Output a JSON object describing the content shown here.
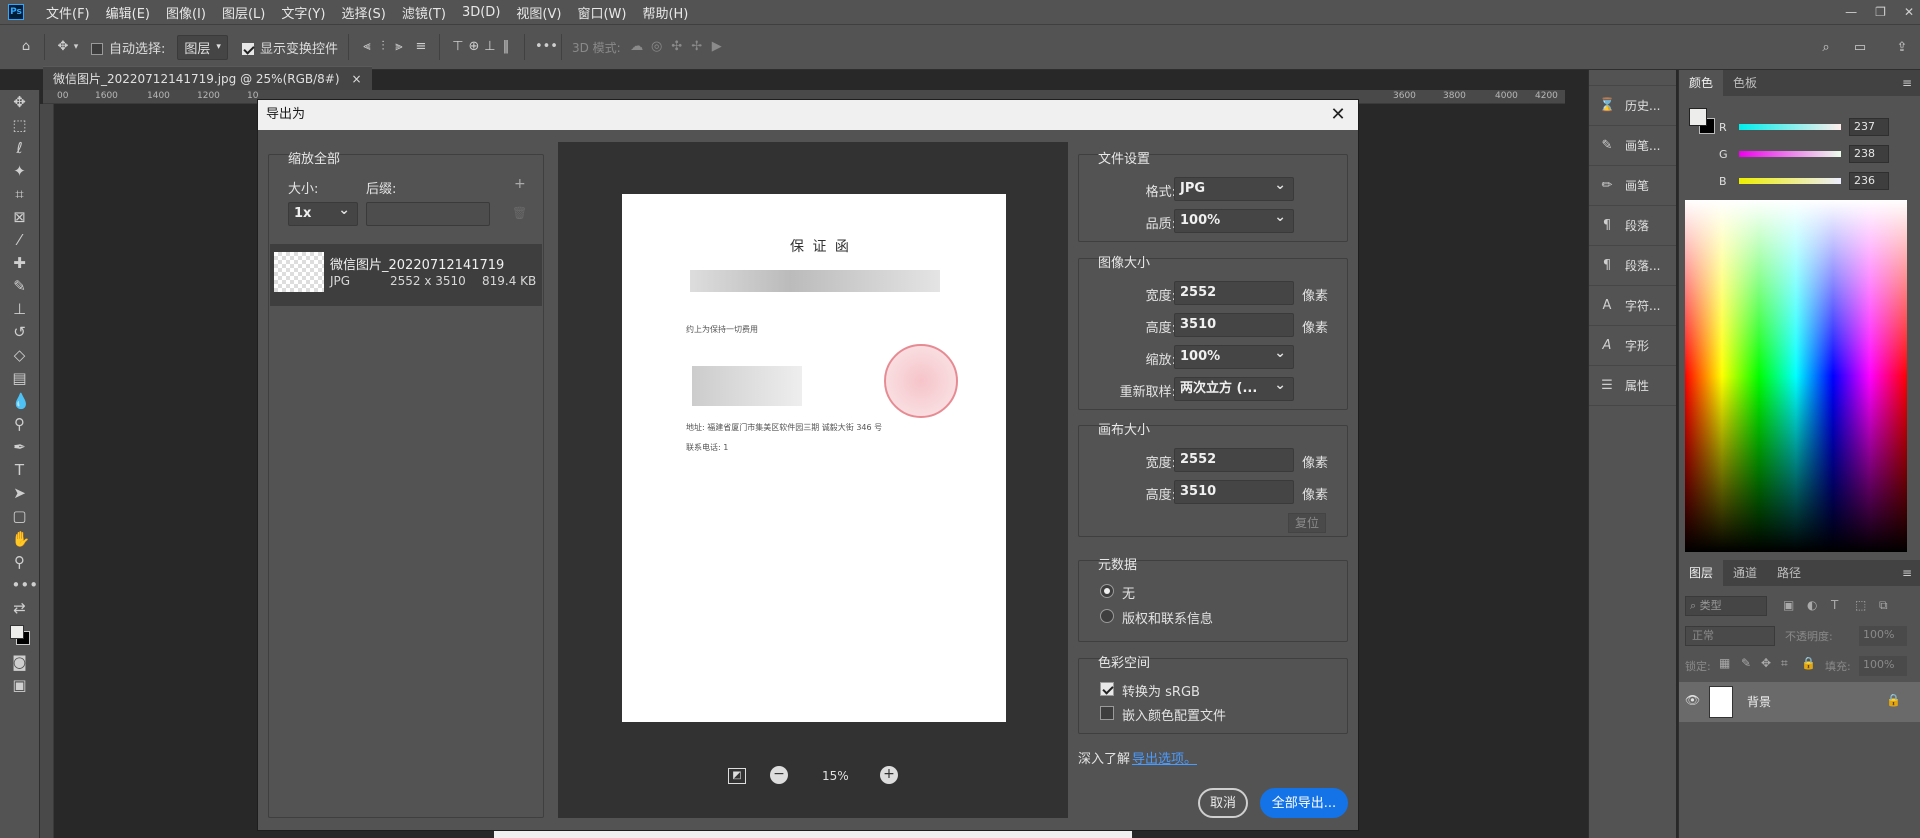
{
  "menubar": {
    "logo": "Ps",
    "items": [
      "文件(F)",
      "编辑(E)",
      "图像(I)",
      "图层(L)",
      "文字(Y)",
      "选择(S)",
      "滤镜(T)",
      "3D(D)",
      "视图(V)",
      "窗口(W)",
      "帮助(H)"
    ]
  },
  "options": {
    "auto_select": "自动选择:",
    "layer_dd": "图层",
    "show_transform": "显示变换控件",
    "mode_3d": "3D 模式:"
  },
  "document_tab": "微信图片_20220712141719.jpg @ 25%(RGB/8#)",
  "ruler_top": [
    "00",
    "1600",
    "1400",
    "1200",
    "10",
    "3600",
    "3800",
    "4000",
    "4200"
  ],
  "right_icons": [
    "历史...",
    "画笔...",
    "画笔",
    "段落",
    "段落...",
    "字符...",
    "字形",
    "属性"
  ],
  "color_panel": {
    "tabs": [
      "颜色",
      "色板"
    ],
    "r": "237",
    "g": "238",
    "b": "236",
    "r_label": "R",
    "g_label": "G",
    "b_label": "B"
  },
  "layers_panel": {
    "tabs": [
      "图层",
      "通道",
      "路径"
    ],
    "kind": "类型",
    "blend": "正常",
    "opacity_label": "不透明度:",
    "opacity": "100%",
    "lock_label": "锁定:",
    "fill_label": "填充:",
    "fill": "100%",
    "layer_name": "背景"
  },
  "dialog": {
    "title": "导出为",
    "scale_all": "缩放全部",
    "size_label": "大小:",
    "suffix_label": "后缀:",
    "size_value": "1x",
    "file_name": "微信图片_20220712141719",
    "file_format": "JPG",
    "file_dims": "2552 x 3510",
    "file_size": "819.4 KB",
    "zoom": "15%",
    "preview_doc_title": "保 证 函",
    "preview_line1": "约上为保持一切费用",
    "preview_line2": "地址: 福建省厦门市集美区软件园三期 诚毅大街 346 号",
    "preview_line3": "联系电话: 1",
    "file_settings": "文件设置",
    "format_label": "格式:",
    "format_value": "JPG",
    "quality_label": "品质:",
    "quality_value": "100%",
    "image_size": "图像大小",
    "width_label": "宽度:",
    "width_value": "2552",
    "height_label": "高度:",
    "height_value": "3510",
    "px": "像素",
    "scale_label": "缩放:",
    "scale_value": "100%",
    "resample_label": "重新取样:",
    "resample_value": "两次立方 (...",
    "canvas_size": "画布大小",
    "canvas_width_label": "宽度:",
    "canvas_width_value": "2552",
    "canvas_height_label": "高度:",
    "canvas_height_value": "3510",
    "reset": "复位",
    "metadata": "元数据",
    "meta_none": "无",
    "meta_copyright": "版权和联系信息",
    "colorspace": "色彩空间",
    "to_srgb": "转换为 sRGB",
    "embed_profile": "嵌入颜色配置文件",
    "learn_more": "深入了解",
    "export_options_link": "导出选项。",
    "cancel": "取消",
    "export_all": "全部导出..."
  },
  "colors": {
    "accent": "#1473e6",
    "link": "#4a9bff",
    "panel": "#535353",
    "dialog_title_bg": "#f0f0f0"
  }
}
